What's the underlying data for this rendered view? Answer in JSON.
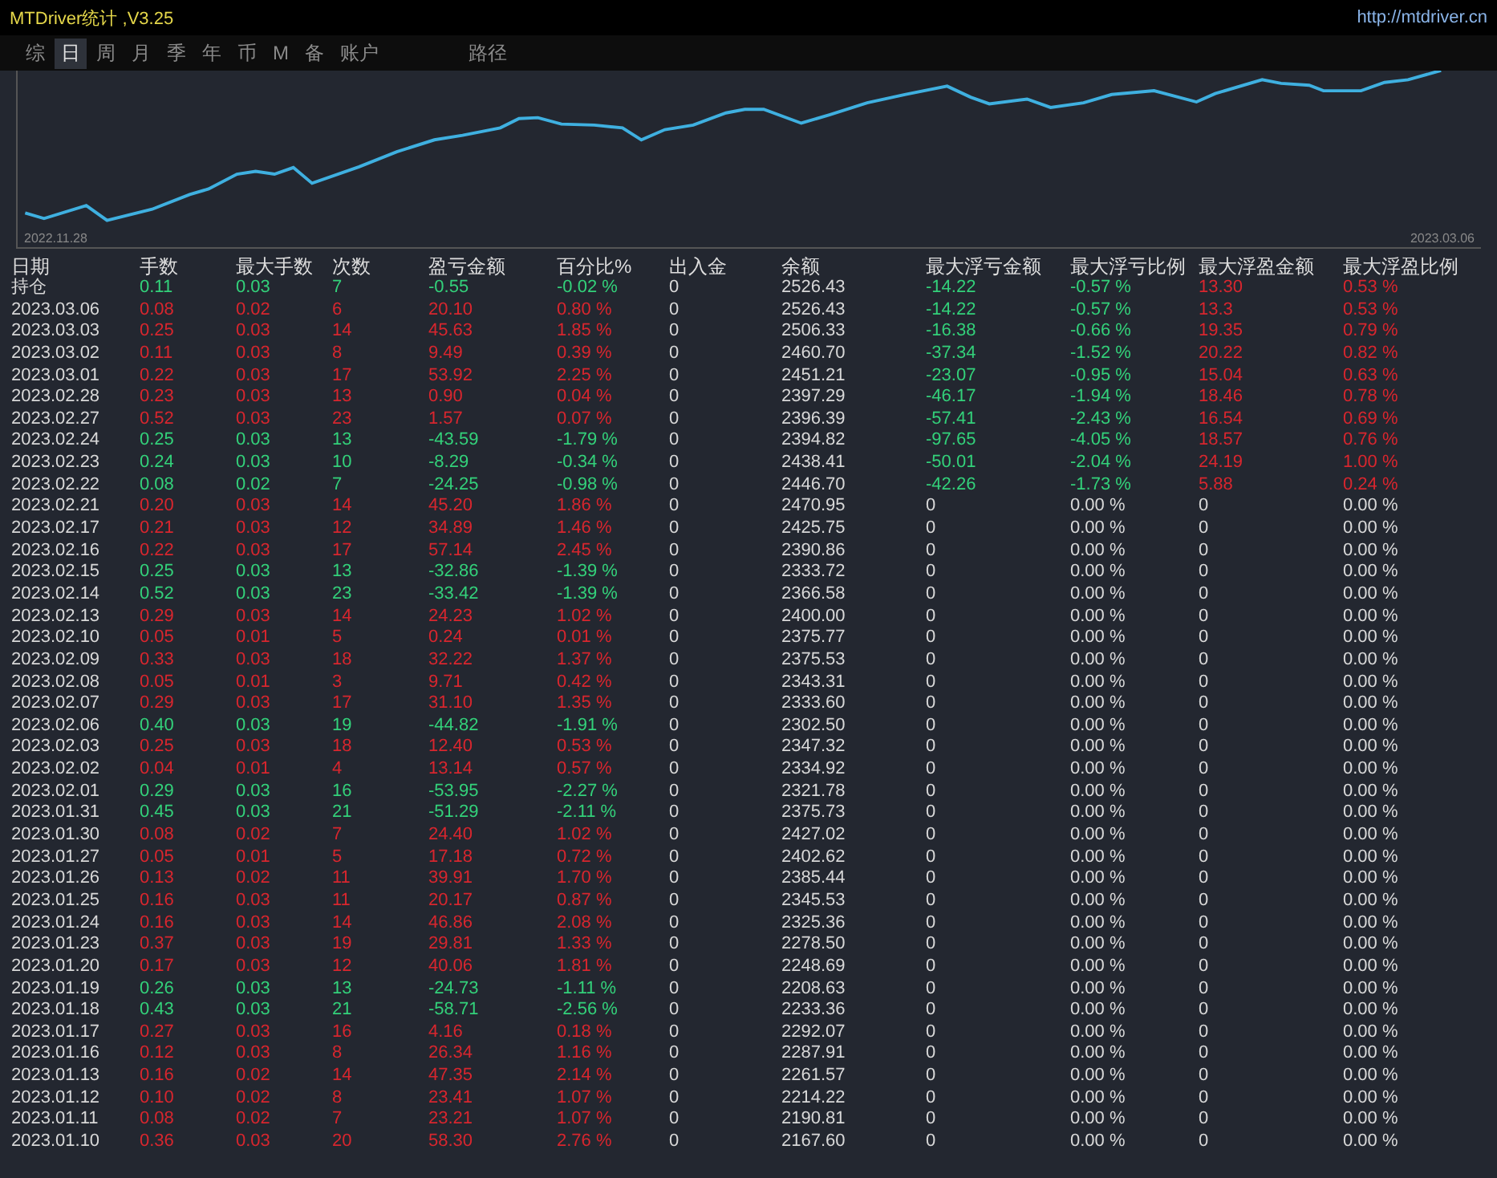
{
  "window": {
    "title": "MTDriver统计 ,V3.25",
    "url": "http://mtdriver.cn"
  },
  "tabs": [
    {
      "label": "综",
      "selected": false
    },
    {
      "label": "日",
      "selected": true
    },
    {
      "label": "周",
      "selected": false
    },
    {
      "label": "月",
      "selected": false
    },
    {
      "label": "季",
      "selected": false
    },
    {
      "label": "年",
      "selected": false
    },
    {
      "label": "币",
      "selected": false
    },
    {
      "label": "M",
      "selected": false
    },
    {
      "label": "备",
      "selected": false
    },
    {
      "label": "账户",
      "selected": false
    }
  ],
  "path_tab": {
    "label": "路径",
    "selected": false
  },
  "chart": {
    "start_date": "2022.11.28",
    "end_date": "2023.03.06"
  },
  "table": {
    "columns": [
      "日期",
      "手数",
      "最大手数",
      "次数",
      "盈亏金额",
      "百分比%",
      "出入金",
      "余额",
      "最大浮亏金额",
      "最大浮亏比例",
      "最大浮盈金额",
      "最大浮盈比例"
    ],
    "rows": [
      {
        "cells": [
          "持仓",
          "0.11",
          "0.03",
          "7",
          "-0.55",
          "-0.02 %",
          "0",
          "2526.43",
          "-14.22",
          "-0.57 %",
          "13.30",
          "0.53 %"
        ],
        "kind": "loss",
        "floating": true
      },
      {
        "cells": [
          "2023.03.06",
          "0.08",
          "0.02",
          "6",
          "20.10",
          "0.80 %",
          "0",
          "2526.43",
          "-14.22",
          "-0.57 %",
          "13.3",
          "0.53 %"
        ],
        "kind": "profit",
        "floating": true
      },
      {
        "cells": [
          "2023.03.03",
          "0.25",
          "0.03",
          "14",
          "45.63",
          "1.85 %",
          "0",
          "2506.33",
          "-16.38",
          "-0.66 %",
          "19.35",
          "0.79 %"
        ],
        "kind": "profit",
        "floating": true
      },
      {
        "cells": [
          "2023.03.02",
          "0.11",
          "0.03",
          "8",
          "9.49",
          "0.39 %",
          "0",
          "2460.70",
          "-37.34",
          "-1.52 %",
          "20.22",
          "0.82 %"
        ],
        "kind": "profit",
        "floating": true
      },
      {
        "cells": [
          "2023.03.01",
          "0.22",
          "0.03",
          "17",
          "53.92",
          "2.25 %",
          "0",
          "2451.21",
          "-23.07",
          "-0.95 %",
          "15.04",
          "0.63 %"
        ],
        "kind": "profit",
        "floating": true
      },
      {
        "cells": [
          "2023.02.28",
          "0.23",
          "0.03",
          "13",
          "0.90",
          "0.04 %",
          "0",
          "2397.29",
          "-46.17",
          "-1.94 %",
          "18.46",
          "0.78 %"
        ],
        "kind": "profit",
        "floating": true
      },
      {
        "cells": [
          "2023.02.27",
          "0.52",
          "0.03",
          "23",
          "1.57",
          "0.07 %",
          "0",
          "2396.39",
          "-57.41",
          "-2.43 %",
          "16.54",
          "0.69 %"
        ],
        "kind": "profit",
        "floating": true
      },
      {
        "cells": [
          "2023.02.24",
          "0.25",
          "0.03",
          "13",
          "-43.59",
          "-1.79 %",
          "0",
          "2394.82",
          "-97.65",
          "-4.05 %",
          "18.57",
          "0.76 %"
        ],
        "kind": "loss",
        "floating": true
      },
      {
        "cells": [
          "2023.02.23",
          "0.24",
          "0.03",
          "10",
          "-8.29",
          "-0.34 %",
          "0",
          "2438.41",
          "-50.01",
          "-2.04 %",
          "24.19",
          "1.00 %"
        ],
        "kind": "loss",
        "floating": true
      },
      {
        "cells": [
          "2023.02.22",
          "0.08",
          "0.02",
          "7",
          "-24.25",
          "-0.98 %",
          "0",
          "2446.70",
          "-42.26",
          "-1.73 %",
          "5.88",
          "0.24 %"
        ],
        "kind": "loss",
        "floating": true
      },
      {
        "cells": [
          "2023.02.21",
          "0.20",
          "0.03",
          "14",
          "45.20",
          "1.86 %",
          "0",
          "2470.95",
          "0",
          "0.00 %",
          "0",
          "0.00 %"
        ],
        "kind": "profit",
        "floating": false
      },
      {
        "cells": [
          "2023.02.17",
          "0.21",
          "0.03",
          "12",
          "34.89",
          "1.46 %",
          "0",
          "2425.75",
          "0",
          "0.00 %",
          "0",
          "0.00 %"
        ],
        "kind": "profit",
        "floating": false
      },
      {
        "cells": [
          "2023.02.16",
          "0.22",
          "0.03",
          "17",
          "57.14",
          "2.45 %",
          "0",
          "2390.86",
          "0",
          "0.00 %",
          "0",
          "0.00 %"
        ],
        "kind": "profit",
        "floating": false
      },
      {
        "cells": [
          "2023.02.15",
          "0.25",
          "0.03",
          "13",
          "-32.86",
          "-1.39 %",
          "0",
          "2333.72",
          "0",
          "0.00 %",
          "0",
          "0.00 %"
        ],
        "kind": "loss",
        "floating": false
      },
      {
        "cells": [
          "2023.02.14",
          "0.52",
          "0.03",
          "23",
          "-33.42",
          "-1.39 %",
          "0",
          "2366.58",
          "0",
          "0.00 %",
          "0",
          "0.00 %"
        ],
        "kind": "loss",
        "floating": false
      },
      {
        "cells": [
          "2023.02.13",
          "0.29",
          "0.03",
          "14",
          "24.23",
          "1.02 %",
          "0",
          "2400.00",
          "0",
          "0.00 %",
          "0",
          "0.00 %"
        ],
        "kind": "profit",
        "floating": false
      },
      {
        "cells": [
          "2023.02.10",
          "0.05",
          "0.01",
          "5",
          "0.24",
          "0.01 %",
          "0",
          "2375.77",
          "0",
          "0.00 %",
          "0",
          "0.00 %"
        ],
        "kind": "profit",
        "floating": false
      },
      {
        "cells": [
          "2023.02.09",
          "0.33",
          "0.03",
          "18",
          "32.22",
          "1.37 %",
          "0",
          "2375.53",
          "0",
          "0.00 %",
          "0",
          "0.00 %"
        ],
        "kind": "profit",
        "floating": false
      },
      {
        "cells": [
          "2023.02.08",
          "0.05",
          "0.01",
          "3",
          "9.71",
          "0.42 %",
          "0",
          "2343.31",
          "0",
          "0.00 %",
          "0",
          "0.00 %"
        ],
        "kind": "profit",
        "floating": false
      },
      {
        "cells": [
          "2023.02.07",
          "0.29",
          "0.03",
          "17",
          "31.10",
          "1.35 %",
          "0",
          "2333.60",
          "0",
          "0.00 %",
          "0",
          "0.00 %"
        ],
        "kind": "profit",
        "floating": false
      },
      {
        "cells": [
          "2023.02.06",
          "0.40",
          "0.03",
          "19",
          "-44.82",
          "-1.91 %",
          "0",
          "2302.50",
          "0",
          "0.00 %",
          "0",
          "0.00 %"
        ],
        "kind": "loss",
        "floating": false
      },
      {
        "cells": [
          "2023.02.03",
          "0.25",
          "0.03",
          "18",
          "12.40",
          "0.53 %",
          "0",
          "2347.32",
          "0",
          "0.00 %",
          "0",
          "0.00 %"
        ],
        "kind": "profit",
        "floating": false
      },
      {
        "cells": [
          "2023.02.02",
          "0.04",
          "0.01",
          "4",
          "13.14",
          "0.57 %",
          "0",
          "2334.92",
          "0",
          "0.00 %",
          "0",
          "0.00 %"
        ],
        "kind": "profit",
        "floating": false
      },
      {
        "cells": [
          "2023.02.01",
          "0.29",
          "0.03",
          "16",
          "-53.95",
          "-2.27 %",
          "0",
          "2321.78",
          "0",
          "0.00 %",
          "0",
          "0.00 %"
        ],
        "kind": "loss",
        "floating": false
      },
      {
        "cells": [
          "2023.01.31",
          "0.45",
          "0.03",
          "21",
          "-51.29",
          "-2.11 %",
          "0",
          "2375.73",
          "0",
          "0.00 %",
          "0",
          "0.00 %"
        ],
        "kind": "loss",
        "floating": false
      },
      {
        "cells": [
          "2023.01.30",
          "0.08",
          "0.02",
          "7",
          "24.40",
          "1.02 %",
          "0",
          "2427.02",
          "0",
          "0.00 %",
          "0",
          "0.00 %"
        ],
        "kind": "profit",
        "floating": false
      },
      {
        "cells": [
          "2023.01.27",
          "0.05",
          "0.01",
          "5",
          "17.18",
          "0.72 %",
          "0",
          "2402.62",
          "0",
          "0.00 %",
          "0",
          "0.00 %"
        ],
        "kind": "profit",
        "floating": false
      },
      {
        "cells": [
          "2023.01.26",
          "0.13",
          "0.02",
          "11",
          "39.91",
          "1.70 %",
          "0",
          "2385.44",
          "0",
          "0.00 %",
          "0",
          "0.00 %"
        ],
        "kind": "profit",
        "floating": false
      },
      {
        "cells": [
          "2023.01.25",
          "0.16",
          "0.03",
          "11",
          "20.17",
          "0.87 %",
          "0",
          "2345.53",
          "0",
          "0.00 %",
          "0",
          "0.00 %"
        ],
        "kind": "profit",
        "floating": false
      },
      {
        "cells": [
          "2023.01.24",
          "0.16",
          "0.03",
          "14",
          "46.86",
          "2.08 %",
          "0",
          "2325.36",
          "0",
          "0.00 %",
          "0",
          "0.00 %"
        ],
        "kind": "profit",
        "floating": false
      },
      {
        "cells": [
          "2023.01.23",
          "0.37",
          "0.03",
          "19",
          "29.81",
          "1.33 %",
          "0",
          "2278.50",
          "0",
          "0.00 %",
          "0",
          "0.00 %"
        ],
        "kind": "profit",
        "floating": false
      },
      {
        "cells": [
          "2023.01.20",
          "0.17",
          "0.03",
          "12",
          "40.06",
          "1.81 %",
          "0",
          "2248.69",
          "0",
          "0.00 %",
          "0",
          "0.00 %"
        ],
        "kind": "profit",
        "floating": false
      },
      {
        "cells": [
          "2023.01.19",
          "0.26",
          "0.03",
          "13",
          "-24.73",
          "-1.11 %",
          "0",
          "2208.63",
          "0",
          "0.00 %",
          "0",
          "0.00 %"
        ],
        "kind": "loss",
        "floating": false
      },
      {
        "cells": [
          "2023.01.18",
          "0.43",
          "0.03",
          "21",
          "-58.71",
          "-2.56 %",
          "0",
          "2233.36",
          "0",
          "0.00 %",
          "0",
          "0.00 %"
        ],
        "kind": "loss",
        "floating": false
      },
      {
        "cells": [
          "2023.01.17",
          "0.27",
          "0.03",
          "16",
          "4.16",
          "0.18 %",
          "0",
          "2292.07",
          "0",
          "0.00 %",
          "0",
          "0.00 %"
        ],
        "kind": "profit",
        "floating": false
      },
      {
        "cells": [
          "2023.01.16",
          "0.12",
          "0.03",
          "8",
          "26.34",
          "1.16 %",
          "0",
          "2287.91",
          "0",
          "0.00 %",
          "0",
          "0.00 %"
        ],
        "kind": "profit",
        "floating": false
      },
      {
        "cells": [
          "2023.01.13",
          "0.16",
          "0.02",
          "14",
          "47.35",
          "2.14 %",
          "0",
          "2261.57",
          "0",
          "0.00 %",
          "0",
          "0.00 %"
        ],
        "kind": "profit",
        "floating": false
      },
      {
        "cells": [
          "2023.01.12",
          "0.10",
          "0.02",
          "8",
          "23.41",
          "1.07 %",
          "0",
          "2214.22",
          "0",
          "0.00 %",
          "0",
          "0.00 %"
        ],
        "kind": "profit",
        "floating": false
      },
      {
        "cells": [
          "2023.01.11",
          "0.08",
          "0.02",
          "7",
          "23.21",
          "1.07 %",
          "0",
          "2190.81",
          "0",
          "0.00 %",
          "0",
          "0.00 %"
        ],
        "kind": "profit",
        "floating": false
      },
      {
        "cells": [
          "2023.01.10",
          "0.36",
          "0.03",
          "20",
          "58.30",
          "2.76 %",
          "0",
          "2167.60",
          "0",
          "0.00 %",
          "0",
          "0.00 %"
        ],
        "kind": "profit",
        "floating": false
      }
    ]
  }
}
